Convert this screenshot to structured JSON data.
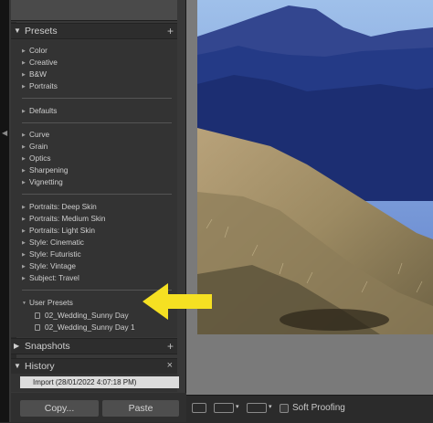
{
  "presets": {
    "title": "Presets",
    "add": "+",
    "group1": [
      "Color",
      "Creative",
      "B&W",
      "Portraits"
    ],
    "group2": [
      "Defaults"
    ],
    "group3": [
      "Curve",
      "Grain",
      "Optics",
      "Sharpening",
      "Vignetting"
    ],
    "group4": [
      "Portraits: Deep Skin",
      "Portraits: Medium Skin",
      "Portraits: Light Skin",
      "Style: Cinematic",
      "Style: Futuristic",
      "Style: Vintage",
      "Subject: Travel"
    ],
    "user_presets": {
      "label": "User Presets",
      "items": [
        "02_Wedding_Sunny Day",
        "02_Wedding_Sunny Day 1"
      ]
    }
  },
  "snapshots": {
    "title": "Snapshots",
    "add": "+"
  },
  "history": {
    "title": "History",
    "close": "×",
    "entry": "Import (28/01/2022 4:07:18 PM)"
  },
  "buttons": {
    "copy": "Copy...",
    "paste": "Paste"
  },
  "toolbar": {
    "soft_proofing": "Soft Proofing"
  },
  "colors": {
    "arrow": "#f5e022",
    "panel": "#383838",
    "header": "#2d2d2d"
  }
}
